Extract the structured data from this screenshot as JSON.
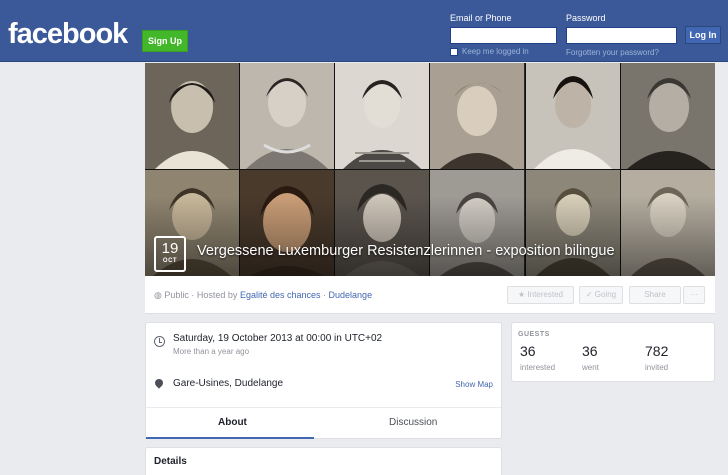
{
  "header": {
    "logo": "facebook",
    "signup_label": "Sign Up",
    "email_label": "Email or Phone",
    "password_label": "Password",
    "keep_logged_in": "Keep me logged in",
    "forgot_password": "Forgotten your password?",
    "login_label": "Log In",
    "brand_color": "#3b5998"
  },
  "event": {
    "date_day": "19",
    "date_month": "OCT",
    "title": "Vergessene Luxemburger Resistenzlerinnen - exposition bilingue",
    "privacy": "Public",
    "hosted_by_prefix": "Hosted by",
    "host_1": "Egalité des chances",
    "host_separator": "·",
    "host_2": "Dudelange"
  },
  "actions": {
    "interested": "★ Interested",
    "going": "✓ Going",
    "share": "Share",
    "more": "···"
  },
  "info": {
    "datetime": "Saturday, 19 October 2013 at 00:00 in UTC+02",
    "datetime_sub": "More than a year ago",
    "location": "Gare-Usines, Dudelange",
    "show_map": "Show Map"
  },
  "tabs": {
    "about": "About",
    "discussion": "Discussion"
  },
  "guests": {
    "title": "GUESTS",
    "interested_count": "36",
    "interested_label": "interested",
    "went_count": "36",
    "went_label": "went",
    "invited_count": "782",
    "invited_label": "invited"
  },
  "details": {
    "title": "Details"
  }
}
